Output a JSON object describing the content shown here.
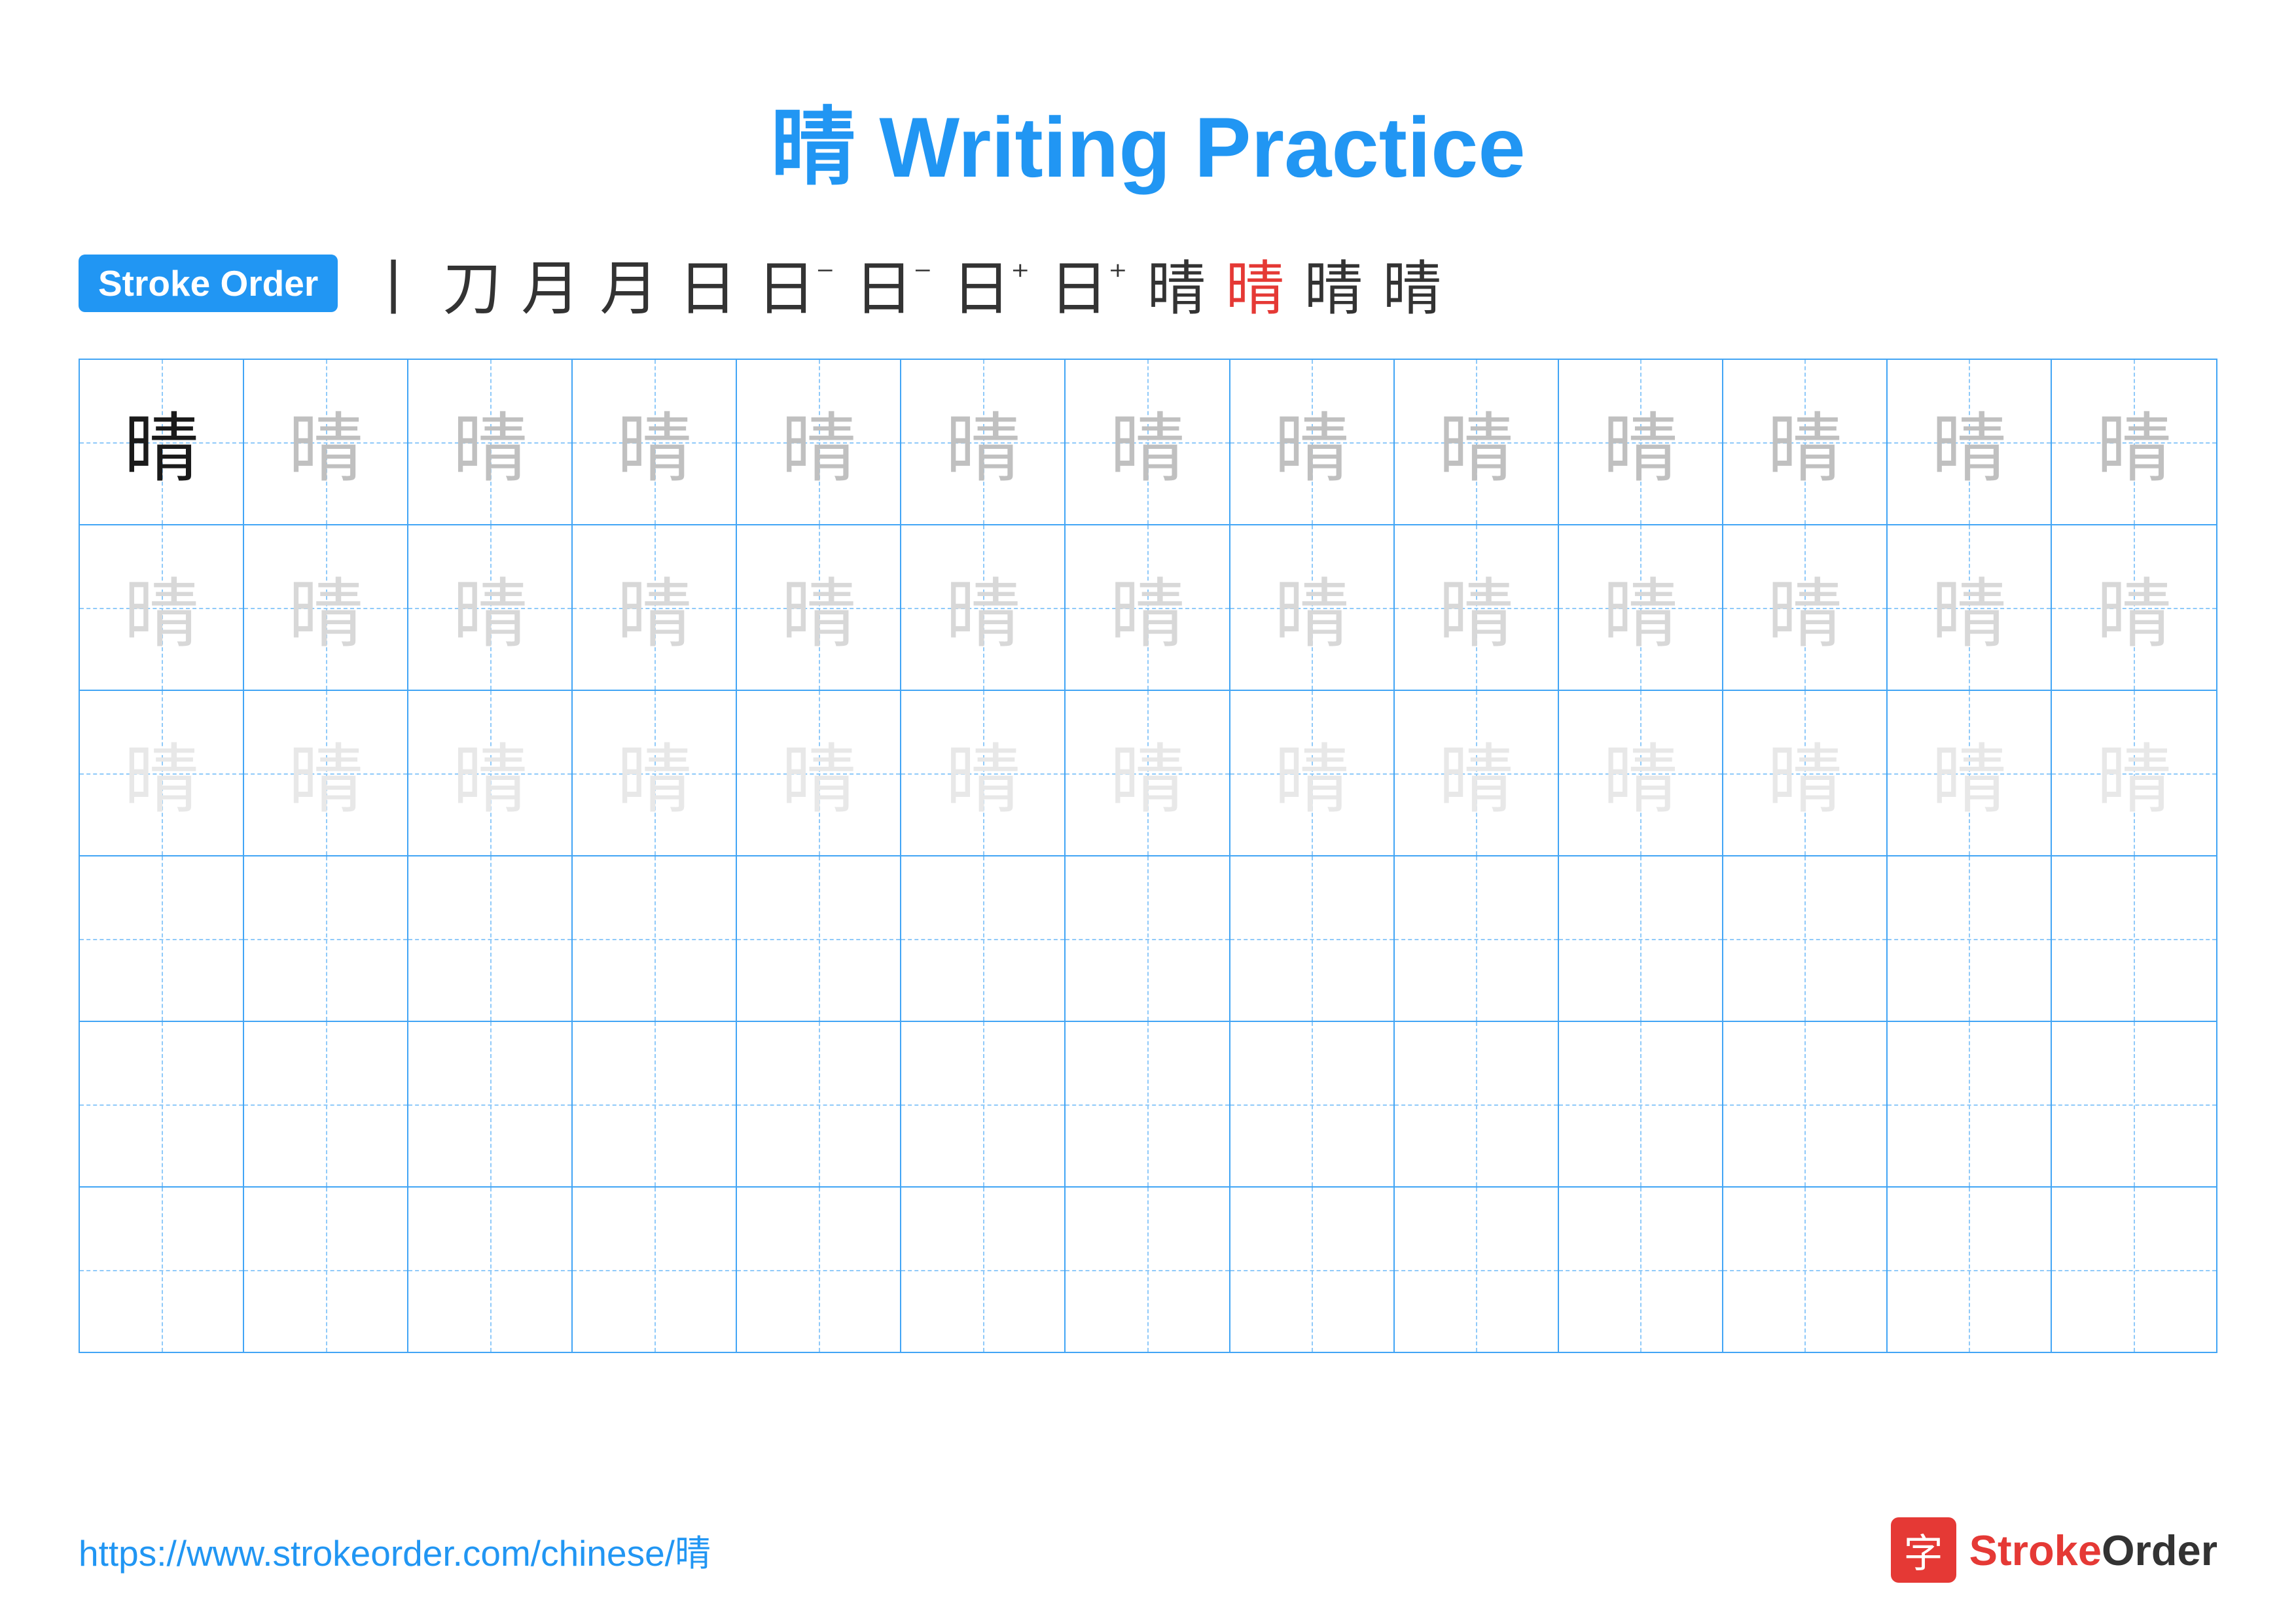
{
  "page": {
    "title": "晴 Writing Practice",
    "url": "https://www.strokeorder.com/chinese/晴",
    "logo_text": "StrokeOrder",
    "logo_char": "字"
  },
  "stroke_order": {
    "badge_label": "Stroke Order",
    "steps": [
      "丨",
      "刀",
      "月",
      "月",
      "日",
      "日⁻",
      "日⁻",
      "日⁺",
      "日⁺",
      "晴",
      "晴",
      "晴",
      "晴"
    ]
  },
  "character": "晴",
  "grid": {
    "rows": 6,
    "cols": 13,
    "row_types": [
      "dark-then-medium",
      "light",
      "very-light",
      "empty",
      "empty",
      "empty"
    ]
  }
}
